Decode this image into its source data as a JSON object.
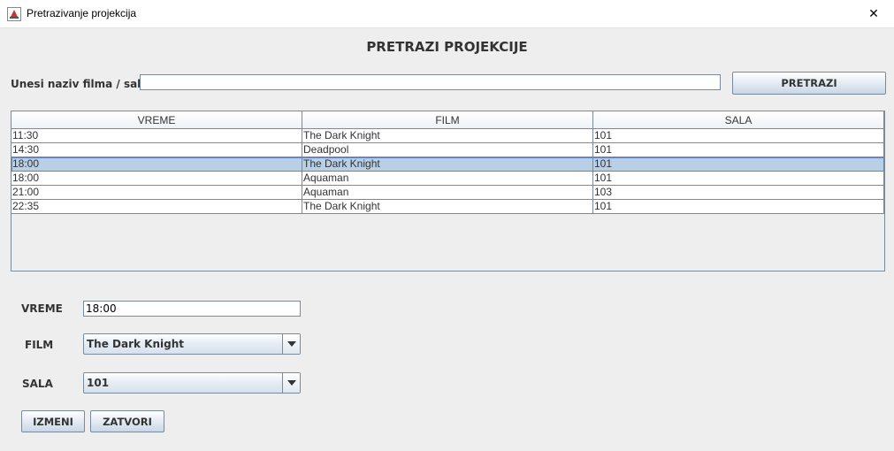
{
  "window": {
    "title": "Pretrazivanje projekcija",
    "close_glyph": "✕",
    "icon": "java-cup-icon"
  },
  "heading": "PRETRAZI PROJEKCIJE",
  "search": {
    "label": "Unesi naziv filma / sale",
    "value": "",
    "button": "PRETRAZI"
  },
  "table": {
    "columns": [
      "VREME",
      "FILM",
      "SALA"
    ],
    "rows": [
      [
        "11:30",
        "The Dark Knight",
        "101"
      ],
      [
        "14:30",
        "Deadpool",
        "101"
      ],
      [
        "18:00",
        "The Dark Knight",
        "101"
      ],
      [
        "18:00",
        "Aquaman",
        "101"
      ],
      [
        "21:00",
        "Aquaman",
        "103"
      ],
      [
        "22:35",
        "The Dark Knight",
        "101"
      ]
    ],
    "selected_row": 2
  },
  "form": {
    "vreme_label": "VREME",
    "vreme_value": "18:00",
    "film_label": "FILM",
    "film_value": "The Dark Knight",
    "sala_label": "SALA",
    "sala_value": "101"
  },
  "buttons": {
    "izmeni": "IZMENI",
    "zatvori": "ZATVORI"
  },
  "colors": {
    "selection": "#b8cfe5",
    "border": "#7a8a99",
    "background": "#eeeeee"
  }
}
